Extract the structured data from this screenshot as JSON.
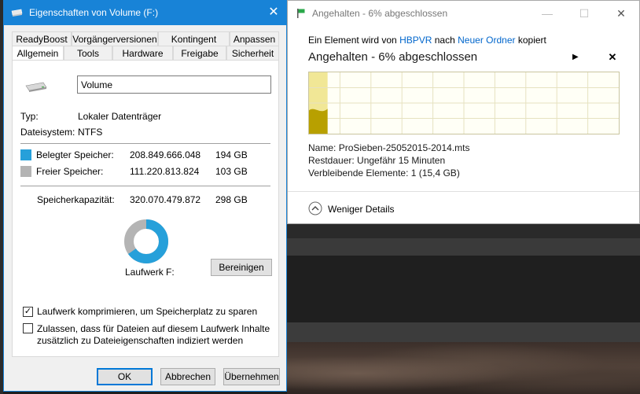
{
  "properties": {
    "title": "Eigenschaften von Volume (F:)",
    "tabs_row1": [
      "ReadyBoost",
      "Vorgängerversionen",
      "Kontingent",
      "Anpassen"
    ],
    "tabs_row2": [
      "Allgemein",
      "Tools",
      "Hardware",
      "Freigabe",
      "Sicherheit"
    ],
    "active_tab": "Allgemein",
    "volume_name": "Volume",
    "type_label": "Typ:",
    "type_value": "Lokaler Datenträger",
    "fs_label": "Dateisystem:",
    "fs_value": "NTFS",
    "used_label": "Belegter Speicher:",
    "used_bytes": "208.849.666.048",
    "used_gb": "194 GB",
    "free_label": "Freier Speicher:",
    "free_bytes": "111.220.813.824",
    "free_gb": "103 GB",
    "capacity_label": "Speicherkapazität:",
    "capacity_bytes": "320.070.479.872",
    "capacity_gb": "298 GB",
    "drive_label": "Laufwerk F:",
    "cleanup_button": "Bereinigen",
    "used_fraction": 0.6525,
    "compress_label": "Laufwerk komprimieren, um Speicherplatz zu sparen",
    "compress_checked": true,
    "index_label_line1": "Zulassen, dass für Dateien auf diesem Laufwerk Inhalte",
    "index_label_line2": "zusätzlich zu Dateieigenschaften indiziert werden",
    "index_checked": false,
    "ok_button": "OK",
    "cancel_button": "Abbrechen",
    "apply_button": "Übernehmen",
    "colors": {
      "used": "#26a0da",
      "free": "#b4b4b4",
      "titlebar": "#1883d7"
    }
  },
  "copy_dialog": {
    "title": "Angehalten - 6% abgeschlossen",
    "line_prefix": "Ein Element wird von",
    "source": "HBPVR",
    "line_mid": "nach",
    "destination": "Neuer Ordner",
    "line_suffix": "kopiert",
    "status": "Angehalten - 6% abgeschlossen",
    "progress_fraction": 0.06,
    "name_label": "Name:",
    "name_value": "ProSieben-25052015-2014.mts",
    "remaining_label": "Restdauer:",
    "remaining_value": "Ungefähr 15 Minuten",
    "items_label": "Verbleibende Elemente:",
    "items_value": "1 (15,4 GB)",
    "less_details": "Weniger Details",
    "colors": {
      "graph_fill": "#b8a000",
      "graph_done": "#f1e796",
      "link": "#0066cc"
    }
  }
}
